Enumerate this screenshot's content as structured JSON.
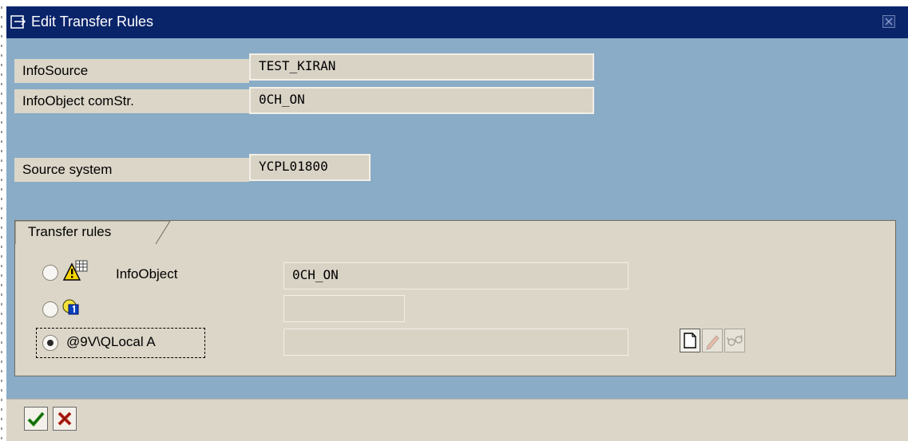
{
  "window": {
    "title": "Edit Transfer Rules"
  },
  "header": {
    "infosource_label": "InfoSource",
    "infosource_value": "TEST_KIRAN",
    "infoobject_comstr_label": "InfoObject comStr.",
    "infoobject_comstr_value": "0CH_ON",
    "source_system_label": "Source system",
    "source_system_value": "YCPL01800"
  },
  "transfer_rules": {
    "title": "Transfer rules",
    "options": [
      {
        "label": "InfoObject",
        "value": "0CH_ON",
        "selected": false,
        "icon": "infoobject-warning-icon"
      },
      {
        "label": "",
        "value": "",
        "selected": false,
        "icon": "constant-value-icon"
      },
      {
        "label": "@9V\\QLocal A",
        "value": "",
        "selected": true,
        "icon": ""
      }
    ],
    "tools": {
      "create": "create-icon",
      "change": "pencil-icon",
      "display": "glasses-icon"
    }
  },
  "footer": {
    "continue": "checkmark-icon",
    "cancel": "cancel-x-icon"
  },
  "colors": {
    "titlebar": "#0a246a",
    "dialog_bg": "#8aacc6",
    "panel_bg": "#dcd6c8"
  }
}
